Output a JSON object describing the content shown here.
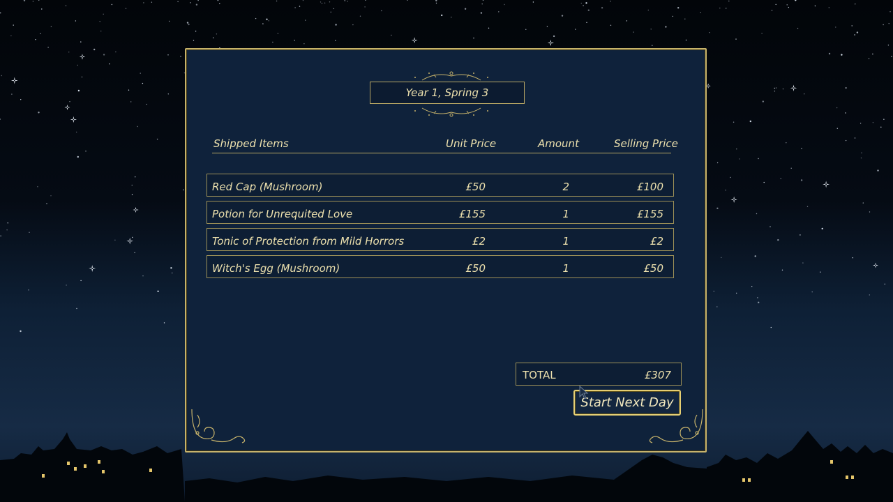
{
  "theme": {
    "accent": "#c7b36b",
    "panel_bg": "#0f223b",
    "text": "#ece0ad"
  },
  "report": {
    "date": "Year 1, Spring 3"
  },
  "table": {
    "headers": {
      "items": "Shipped Items",
      "unit_price": "Unit Price",
      "amount": "Amount",
      "selling_price": "Selling Price"
    },
    "rows": [
      {
        "name": "Red Cap (Mushroom)",
        "unit_price": "£50",
        "amount": "2",
        "selling_price": "£100"
      },
      {
        "name": "Potion for Unrequited Love",
        "unit_price": "£155",
        "amount": "1",
        "selling_price": "£155"
      },
      {
        "name": "Tonic of Protection from Mild Horrors",
        "unit_price": "£2",
        "amount": "1",
        "selling_price": "£2"
      },
      {
        "name": "Witch's Egg (Mushroom)",
        "unit_price": "£50",
        "amount": "1",
        "selling_price": "£50"
      }
    ]
  },
  "total": {
    "label": "TOTAL",
    "value": "£307"
  },
  "actions": {
    "next_day_label": "Start Next Day"
  }
}
